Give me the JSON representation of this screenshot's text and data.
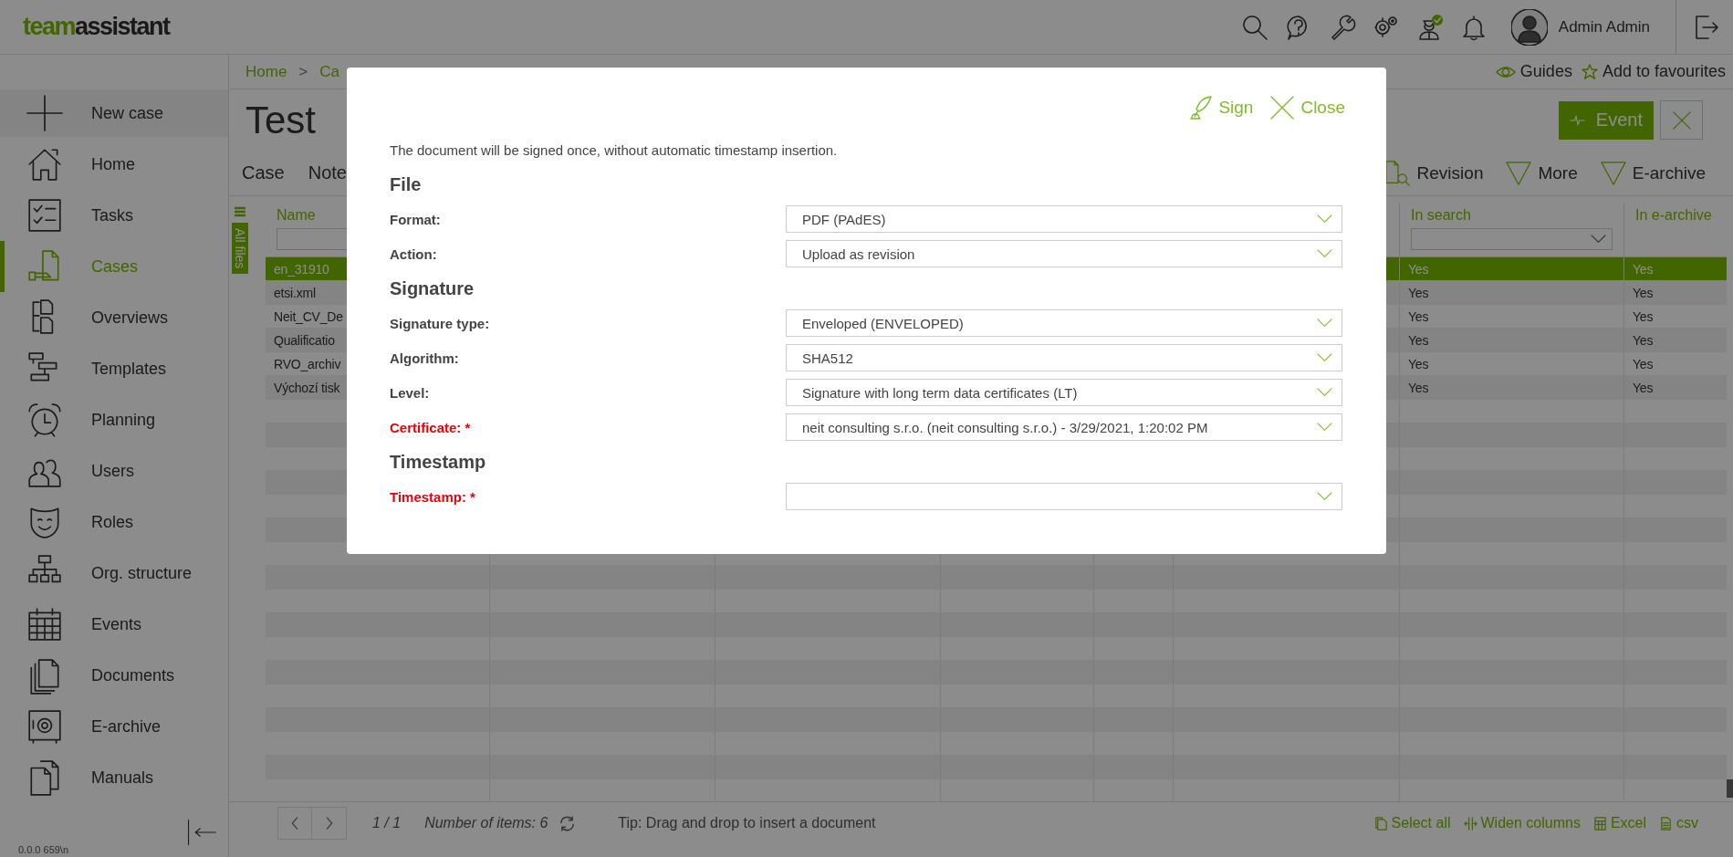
{
  "header": {
    "logo": [
      "team",
      "assistant"
    ],
    "user": "Admin Admin"
  },
  "sidebar": {
    "items": [
      {
        "label": "New case",
        "selected": false
      },
      {
        "label": "Home",
        "selected": false
      },
      {
        "label": "Tasks",
        "selected": false
      },
      {
        "label": "Cases",
        "selected": true
      },
      {
        "label": "Overviews",
        "selected": false
      },
      {
        "label": "Templates",
        "selected": false
      },
      {
        "label": "Planning",
        "selected": false
      },
      {
        "label": "Users",
        "selected": false
      },
      {
        "label": "Roles",
        "selected": false
      },
      {
        "label": "Org. structure",
        "selected": false
      },
      {
        "label": "Events",
        "selected": false
      },
      {
        "label": "Documents",
        "selected": false
      },
      {
        "label": "E-archive",
        "selected": false
      },
      {
        "label": "Manuals",
        "selected": false
      }
    ],
    "version": "0.0.0 659\\n"
  },
  "breadcrumb": [
    "Home",
    ">",
    "Ca"
  ],
  "page_links": [
    "Guides",
    "Add to favourites"
  ],
  "title": "Test",
  "event_button": "Event",
  "tabs": [
    "Case",
    "Note"
  ],
  "toolbar": [
    "Revision",
    "More",
    "E-archive"
  ],
  "table": {
    "side_tab": "All files",
    "columns": [
      "Name",
      "In search",
      "In e-archive"
    ],
    "rows": [
      {
        "name": "en_31910",
        "in_search": "Yes",
        "in_e_archive": "Yes",
        "selected": true
      },
      {
        "name": "etsi.xml",
        "in_search": "Yes",
        "in_e_archive": "Yes",
        "selected": false
      },
      {
        "name": "Neit_CV_De",
        "in_search": "Yes",
        "in_e_archive": "Yes",
        "selected": false
      },
      {
        "name": "Qualificatio",
        "in_search": "Yes",
        "in_e_archive": "Yes",
        "selected": false
      },
      {
        "name": "RVO_archiv",
        "in_search": "Yes",
        "in_e_archive": "Yes",
        "selected": false
      },
      {
        "name": "Výchozí tisk",
        "in_search": "Yes",
        "in_e_archive": "Yes",
        "selected": false
      }
    ]
  },
  "footer": {
    "page": "1 / 1",
    "count": "Number of items: 6",
    "tip": "Tip: Drag and drop to insert a document",
    "actions": [
      "Select all",
      "Widen columns",
      "Excel",
      "csv"
    ]
  },
  "dialog": {
    "actions": [
      "Sign",
      "Close"
    ],
    "note": "The document will be signed once, without automatic timestamp insertion.",
    "sections": [
      {
        "title": "File",
        "fields": [
          {
            "label": "Format:",
            "value": "PDF (PAdES)",
            "required": false
          },
          {
            "label": "Action:",
            "value": "Upload as revision",
            "required": false
          }
        ]
      },
      {
        "title": "Signature",
        "fields": [
          {
            "label": "Signature type:",
            "value": "Enveloped (ENVELOPED)",
            "required": false
          },
          {
            "label": "Algorithm:",
            "value": "SHA512",
            "required": false
          },
          {
            "label": "Level:",
            "value": "Signature with long term data certificates (LT)",
            "required": false
          },
          {
            "label": "Certificate: *",
            "value": "neit consulting s.r.o. (neit consulting s.r.o.) - 3/29/2021, 1:20:02 PM",
            "required": true
          }
        ]
      },
      {
        "title": "Timestamp",
        "fields": [
          {
            "label": "Timestamp: *",
            "required": true
          }
        ]
      }
    ]
  }
}
